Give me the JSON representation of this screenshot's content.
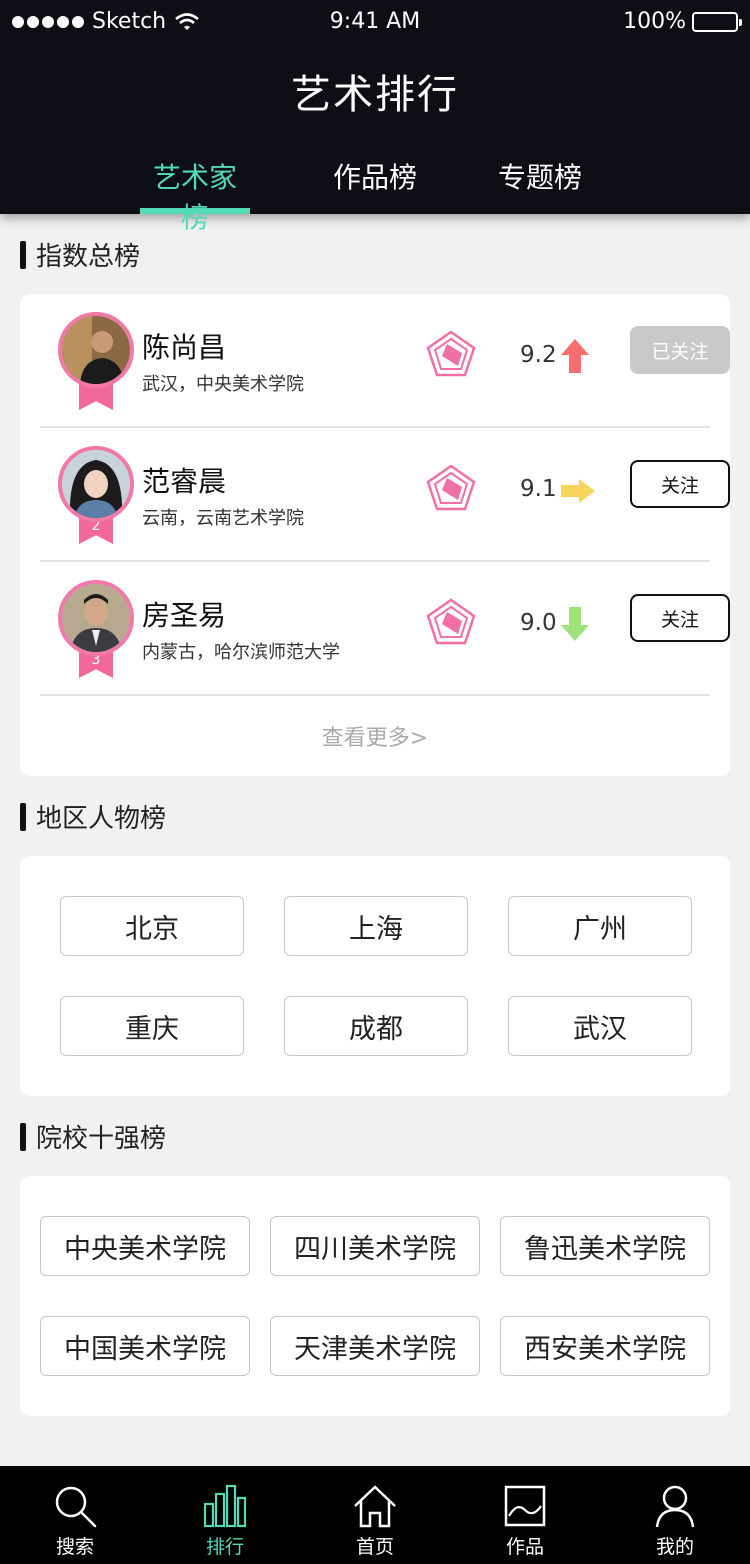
{
  "status_bar": {
    "carrier": "Sketch",
    "time": "9:41 AM",
    "battery": "100%"
  },
  "header": {
    "title": "艺术排行"
  },
  "tabs": [
    {
      "label": "艺术家榜",
      "active": true
    },
    {
      "label": "作品榜",
      "active": false
    },
    {
      "label": "专题榜",
      "active": false
    }
  ],
  "ranking": {
    "title": "指数总榜",
    "artists": [
      {
        "name": "陈尚昌",
        "location": "武汉，中央美术学院",
        "rank": "",
        "score": "9.2",
        "trend": "up",
        "follow": "已关注",
        "followed": true
      },
      {
        "name": "范睿晨",
        "location": "云南，云南艺术学院",
        "rank": "2",
        "score": "9.1",
        "trend": "flat",
        "follow": "关注",
        "followed": false
      },
      {
        "name": "房圣易",
        "location": "内蒙古，哈尔滨师范大学",
        "rank": "3",
        "score": "9.0",
        "trend": "down",
        "follow": "关注",
        "followed": false
      }
    ],
    "see_more": "查看更多>"
  },
  "regions": {
    "title": "地区人物榜",
    "items": [
      "北京",
      "上海",
      "广州",
      "重庆",
      "成都",
      "武汉"
    ]
  },
  "schools": {
    "title": "院校十强榜",
    "items": [
      "中央美术学院",
      "四川美术学院",
      "鲁迅美术学院",
      "中国美术学院",
      "天津美术学院",
      "西安美术学院"
    ]
  },
  "bottom_nav": [
    {
      "label": "搜索",
      "icon": "search-icon",
      "active": false
    },
    {
      "label": "排行",
      "icon": "bar-chart-icon",
      "active": true
    },
    {
      "label": "首页",
      "icon": "home-icon",
      "active": false
    },
    {
      "label": "作品",
      "icon": "image-icon",
      "active": false
    },
    {
      "label": "我的",
      "icon": "user-icon",
      "active": false
    }
  ],
  "colors": {
    "accent": "#52d9b6",
    "header_bg": "#0d0e16",
    "trend_up": "#f86d6d",
    "trend_flat": "#f7d55a",
    "trend_down": "#9ee27c",
    "ribbon": "#f2689d"
  }
}
